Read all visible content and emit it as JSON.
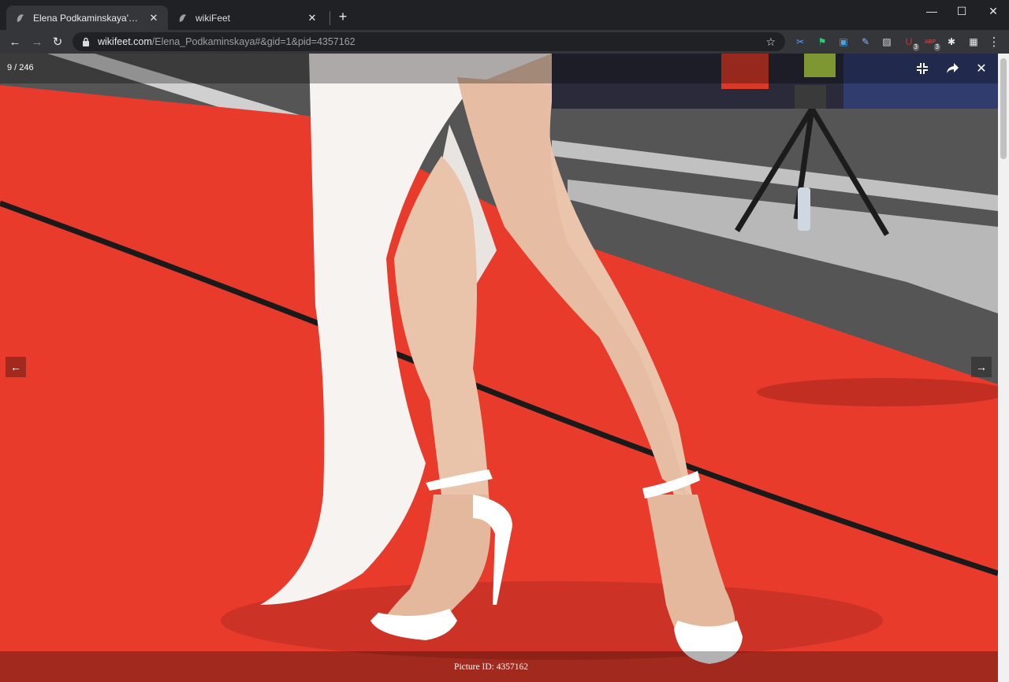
{
  "browser": {
    "tabs": [
      {
        "title": "Elena Podkaminskaya's Feet << w",
        "active": true
      },
      {
        "title": "wikiFeet",
        "active": false
      }
    ],
    "new_tab": "+",
    "url_host": "wikifeet.com",
    "url_path": "/Elena_Podkaminskaya#&gid=1&pid=4357162",
    "extensions": [
      {
        "icon": "scissors-icon",
        "glyph": "✂",
        "color": "#4fa3ff",
        "badge": ""
      },
      {
        "icon": "bird-icon",
        "glyph": "⚑",
        "color": "#2ecc71",
        "badge": ""
      },
      {
        "icon": "window-icon",
        "glyph": "▣",
        "color": "#4aa3df",
        "badge": ""
      },
      {
        "icon": "pen-icon",
        "glyph": "✎",
        "color": "#8ab4f8",
        "badge": ""
      },
      {
        "icon": "image-icon",
        "glyph": "▨",
        "color": "#dadce0",
        "badge": ""
      },
      {
        "icon": "ublock-icon",
        "glyph": "U",
        "color": "#c0392b",
        "badge": "3"
      },
      {
        "icon": "adblock-icon",
        "glyph": "ABP",
        "color": "#e74c3c",
        "badge": "3"
      },
      {
        "icon": "puzzle-icon",
        "glyph": "✱",
        "color": "#e8eaed",
        "badge": ""
      },
      {
        "icon": "profile-icon",
        "glyph": "▦",
        "color": "#e8eaed",
        "badge": ""
      }
    ]
  },
  "viewer": {
    "counter": "9 / 246",
    "caption": "Picture ID: 4357162",
    "prev_arrow": "←",
    "next_arrow": "→"
  },
  "colors": {
    "carpet": "#e83b2b",
    "chrome_dark": "#202124",
    "chrome_toolbar": "#35363a"
  }
}
